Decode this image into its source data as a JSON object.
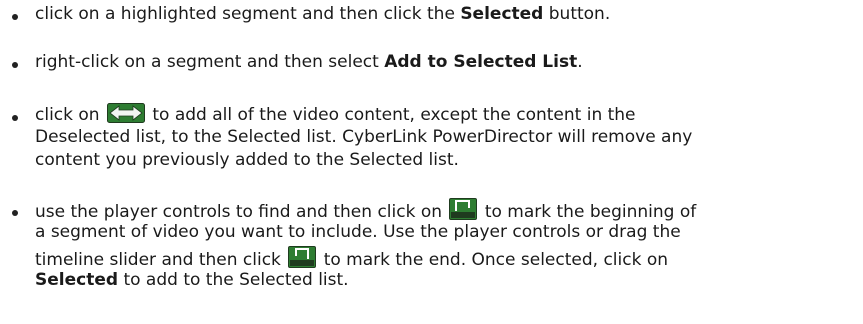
{
  "items": [
    {
      "line1": {
        "pre": "click on a highlighted segment and then click the ",
        "bold": "Selected",
        "post": " button."
      }
    },
    {
      "line1": {
        "pre": "right-click on a segment and then select ",
        "bold": "Add to Selected List",
        "post": "."
      }
    },
    {
      "icon": "double-arrow-add-all-icon",
      "line1": {
        "pre": "click on ",
        "post": " to add all of the video content, except the content in the"
      },
      "line2": "Deselected list, to the Selected list. CyberLink PowerDirector will remove any",
      "line3": "content you previously added to the Selected list."
    },
    {
      "icon_start": "mark-in-icon",
      "icon_end": "mark-out-icon",
      "line1": {
        "pre": "use the player controls to find and then click on ",
        "post": " to mark the beginning of"
      },
      "line2": "a segment of video you want to include. Use the player controls or drag the",
      "line3": {
        "pre": "timeline slider and then click ",
        "post": " to mark the end. Once selected, click on"
      },
      "line4": {
        "bold": "Selected",
        "post": " to add to the Selected list."
      }
    }
  ],
  "colors": {
    "icon_green": "#2e7d32",
    "icon_dark": "#1f3b1f",
    "text": "#1a1a1a"
  }
}
